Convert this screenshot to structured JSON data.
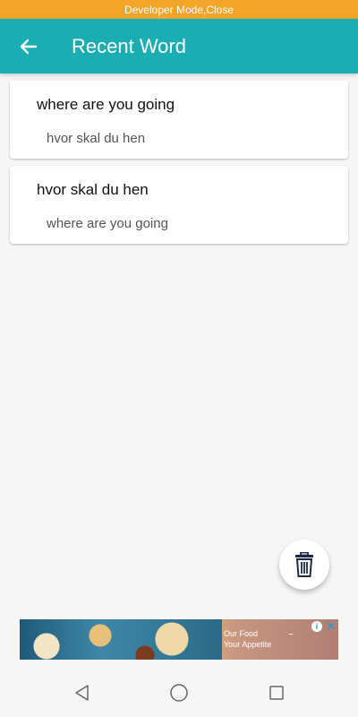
{
  "dev_banner": "Developer Mode,Close",
  "app_bar": {
    "title": "Recent Word",
    "back_icon": "arrow-left-icon"
  },
  "recent_words": [
    {
      "word": "where are you going",
      "translation": "hvor skal du hen"
    },
    {
      "word": "hvor skal du hen",
      "translation": "where are you going"
    }
  ],
  "fab": {
    "icon": "trash-icon"
  },
  "ad": {
    "line1": "Our Food",
    "line2": "Your Appetite",
    "info_icon": "info-icon",
    "close_icon": "close-icon"
  },
  "nav": {
    "back_icon": "nav-back-icon",
    "home_icon": "nav-home-icon",
    "recents_icon": "nav-recents-icon"
  },
  "colors": {
    "primary": "#1aaeb2",
    "dev_banner": "#f3a52a"
  }
}
